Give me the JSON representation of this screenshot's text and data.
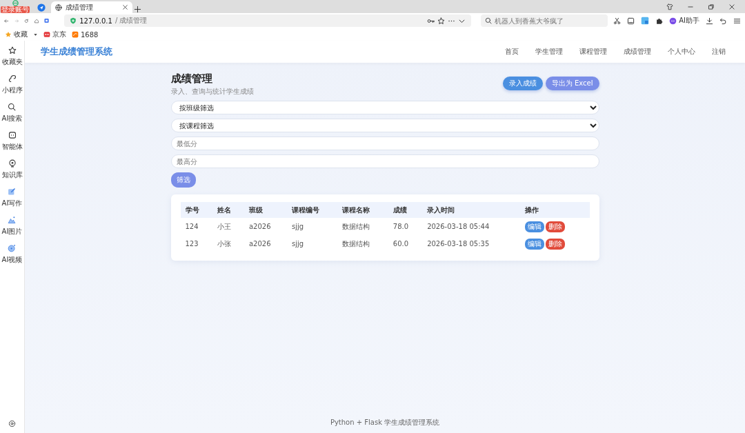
{
  "browser": {
    "account_badge": "登录账号",
    "tabs": [
      {
        "kind": "pinned",
        "selected": false
      },
      {
        "kind": "page",
        "title": "成绩管理",
        "selected": true
      }
    ],
    "address": {
      "host": "127.0.0.1",
      "path": "/ 成绩管理"
    },
    "search": {
      "placeholder": "机器人到香蕉大爷疯了"
    },
    "assistant_label": "AI助手",
    "bookmarks": [
      {
        "kind": "star",
        "label": "收藏"
      },
      {
        "kind": "jd",
        "label": "京东"
      },
      {
        "kind": "ali",
        "label": "1688"
      }
    ]
  },
  "sidebar": {
    "items": [
      {
        "kind": "star",
        "label": "收藏夹"
      },
      {
        "kind": "link",
        "label": "小程序"
      },
      {
        "kind": "search",
        "label": "AI搜索"
      },
      {
        "kind": "bot",
        "label": "智能体"
      },
      {
        "kind": "bulb",
        "label": "知识库"
      },
      {
        "kind": "write",
        "label": "AI写作"
      },
      {
        "kind": "image",
        "label": "AI图片"
      },
      {
        "kind": "video",
        "label": "AI视频"
      }
    ]
  },
  "navbar": {
    "brand": "学生成绩管理系统",
    "links": [
      "首页",
      "学生管理",
      "课程管理",
      "成绩管理",
      "个人中心",
      "注销"
    ]
  },
  "page": {
    "title": "成绩管理",
    "subtitle": "录入、查询与统计学生成绩",
    "actions": [
      {
        "kind": "primary",
        "label": "录入成绩"
      },
      {
        "kind": "secondary",
        "label": "导出为 Excel"
      }
    ],
    "filters": [
      {
        "kind": "select",
        "value": "按班级筛选"
      },
      {
        "kind": "select",
        "value": "按课程筛选"
      },
      {
        "kind": "input",
        "placeholder": "最低分"
      },
      {
        "kind": "input",
        "placeholder": "最高分"
      }
    ],
    "filter_button": "筛选",
    "table": {
      "columns": [
        "学号",
        "姓名",
        "班级",
        "课程编号",
        "课程名称",
        "成绩",
        "录入时间",
        "操作"
      ],
      "rows": [
        {
          "cells": [
            "124",
            "小王",
            "a2026",
            "sjjg",
            "数据结构",
            "78.0",
            "2026-03-18 05:44"
          ],
          "actions": [
            {
              "kind": "edit",
              "label": "编辑"
            },
            {
              "kind": "delete",
              "label": "删除"
            }
          ]
        },
        {
          "cells": [
            "123",
            "小张",
            "a2026",
            "sjjg",
            "数据结构",
            "60.0",
            "2026-03-18 05:35"
          ],
          "actions": [
            {
              "kind": "edit",
              "label": "编辑"
            },
            {
              "kind": "delete",
              "label": "删除"
            }
          ]
        }
      ]
    }
  },
  "footer": "Python + Flask 学生成绩管理系统"
}
